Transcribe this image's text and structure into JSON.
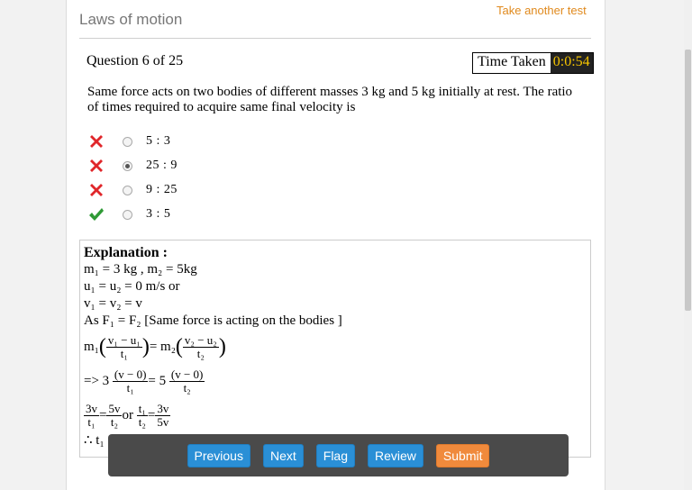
{
  "header": {
    "title": "Laws of motion",
    "take_another": "Take another test"
  },
  "question": {
    "counter": "Question 6 of 25",
    "timer_label": "Time Taken",
    "timer_value": "0:0:54",
    "text": "Same force acts on two bodies of different masses 3 kg and 5 kg initially at rest. The ratio of times required to acquire same final velocity is"
  },
  "options": [
    {
      "label": "5 : 3",
      "result": "wrong",
      "selected": false
    },
    {
      "label": "25 : 9",
      "result": "wrong",
      "selected": true
    },
    {
      "label": "9 : 25",
      "result": "wrong",
      "selected": false
    },
    {
      "label": "3 : 5",
      "result": "correct",
      "selected": false
    }
  ],
  "explanation": {
    "heading": "Explanation :",
    "line1": "m₁ = 3 kg , m₂ = 5kg",
    "line2": "u₁ = u₂ = 0 m/s or",
    "line3": "v₁ = v₂ = v",
    "line4": "As F₁ = F₂ [Same force is acting on the bodies ]",
    "eq1": {
      "m1": "m₁",
      "num1": "v₁ − u₁",
      "den1": "t₁",
      "mid": "= m₂",
      "num2": "v₂ − u₂",
      "den2": "t₂"
    },
    "eq2": {
      "prefix": "=> 3",
      "num1": "(v − 0)",
      "den1": "t₁",
      "mid": "= 5",
      "num2": "(v − 0)",
      "den2": "t₂"
    },
    "eq3": {
      "num1": "3v",
      "den1": "t₁",
      "eq1": "=",
      "num2": "5v",
      "den2": "t₂",
      "or": "or",
      "num3": "t₁",
      "den3": "t₂",
      "eq2": "=",
      "num4": "3v",
      "den4": "5v"
    },
    "line_last": "∴ t₁"
  },
  "nav": {
    "previous": "Previous",
    "next": "Next",
    "flag": "Flag",
    "review": "Review",
    "submit": "Submit"
  },
  "colors": {
    "wrong": "#e0262a",
    "correct": "#2e9a35",
    "primary_button": "#2a8fd6",
    "submit_button": "#f08a3c",
    "link": "#e08a1e"
  }
}
